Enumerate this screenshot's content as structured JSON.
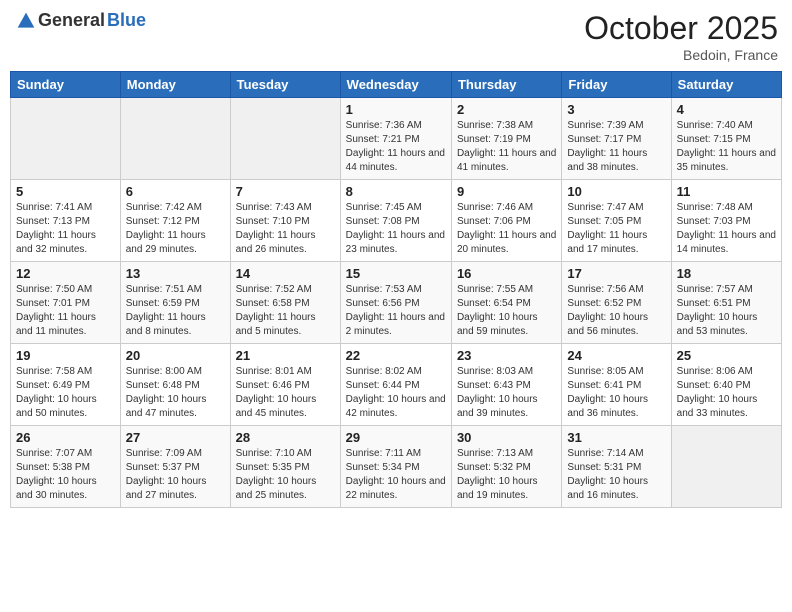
{
  "header": {
    "logo_general": "General",
    "logo_blue": "Blue",
    "month": "October 2025",
    "location": "Bedoin, France"
  },
  "weekdays": [
    "Sunday",
    "Monday",
    "Tuesday",
    "Wednesday",
    "Thursday",
    "Friday",
    "Saturday"
  ],
  "weeks": [
    [
      {
        "day": "",
        "info": ""
      },
      {
        "day": "",
        "info": ""
      },
      {
        "day": "",
        "info": ""
      },
      {
        "day": "1",
        "info": "Sunrise: 7:36 AM\nSunset: 7:21 PM\nDaylight: 11 hours and 44 minutes."
      },
      {
        "day": "2",
        "info": "Sunrise: 7:38 AM\nSunset: 7:19 PM\nDaylight: 11 hours and 41 minutes."
      },
      {
        "day": "3",
        "info": "Sunrise: 7:39 AM\nSunset: 7:17 PM\nDaylight: 11 hours and 38 minutes."
      },
      {
        "day": "4",
        "info": "Sunrise: 7:40 AM\nSunset: 7:15 PM\nDaylight: 11 hours and 35 minutes."
      }
    ],
    [
      {
        "day": "5",
        "info": "Sunrise: 7:41 AM\nSunset: 7:13 PM\nDaylight: 11 hours and 32 minutes."
      },
      {
        "day": "6",
        "info": "Sunrise: 7:42 AM\nSunset: 7:12 PM\nDaylight: 11 hours and 29 minutes."
      },
      {
        "day": "7",
        "info": "Sunrise: 7:43 AM\nSunset: 7:10 PM\nDaylight: 11 hours and 26 minutes."
      },
      {
        "day": "8",
        "info": "Sunrise: 7:45 AM\nSunset: 7:08 PM\nDaylight: 11 hours and 23 minutes."
      },
      {
        "day": "9",
        "info": "Sunrise: 7:46 AM\nSunset: 7:06 PM\nDaylight: 11 hours and 20 minutes."
      },
      {
        "day": "10",
        "info": "Sunrise: 7:47 AM\nSunset: 7:05 PM\nDaylight: 11 hours and 17 minutes."
      },
      {
        "day": "11",
        "info": "Sunrise: 7:48 AM\nSunset: 7:03 PM\nDaylight: 11 hours and 14 minutes."
      }
    ],
    [
      {
        "day": "12",
        "info": "Sunrise: 7:50 AM\nSunset: 7:01 PM\nDaylight: 11 hours and 11 minutes."
      },
      {
        "day": "13",
        "info": "Sunrise: 7:51 AM\nSunset: 6:59 PM\nDaylight: 11 hours and 8 minutes."
      },
      {
        "day": "14",
        "info": "Sunrise: 7:52 AM\nSunset: 6:58 PM\nDaylight: 11 hours and 5 minutes."
      },
      {
        "day": "15",
        "info": "Sunrise: 7:53 AM\nSunset: 6:56 PM\nDaylight: 11 hours and 2 minutes."
      },
      {
        "day": "16",
        "info": "Sunrise: 7:55 AM\nSunset: 6:54 PM\nDaylight: 10 hours and 59 minutes."
      },
      {
        "day": "17",
        "info": "Sunrise: 7:56 AM\nSunset: 6:52 PM\nDaylight: 10 hours and 56 minutes."
      },
      {
        "day": "18",
        "info": "Sunrise: 7:57 AM\nSunset: 6:51 PM\nDaylight: 10 hours and 53 minutes."
      }
    ],
    [
      {
        "day": "19",
        "info": "Sunrise: 7:58 AM\nSunset: 6:49 PM\nDaylight: 10 hours and 50 minutes."
      },
      {
        "day": "20",
        "info": "Sunrise: 8:00 AM\nSunset: 6:48 PM\nDaylight: 10 hours and 47 minutes."
      },
      {
        "day": "21",
        "info": "Sunrise: 8:01 AM\nSunset: 6:46 PM\nDaylight: 10 hours and 45 minutes."
      },
      {
        "day": "22",
        "info": "Sunrise: 8:02 AM\nSunset: 6:44 PM\nDaylight: 10 hours and 42 minutes."
      },
      {
        "day": "23",
        "info": "Sunrise: 8:03 AM\nSunset: 6:43 PM\nDaylight: 10 hours and 39 minutes."
      },
      {
        "day": "24",
        "info": "Sunrise: 8:05 AM\nSunset: 6:41 PM\nDaylight: 10 hours and 36 minutes."
      },
      {
        "day": "25",
        "info": "Sunrise: 8:06 AM\nSunset: 6:40 PM\nDaylight: 10 hours and 33 minutes."
      }
    ],
    [
      {
        "day": "26",
        "info": "Sunrise: 7:07 AM\nSunset: 5:38 PM\nDaylight: 10 hours and 30 minutes."
      },
      {
        "day": "27",
        "info": "Sunrise: 7:09 AM\nSunset: 5:37 PM\nDaylight: 10 hours and 27 minutes."
      },
      {
        "day": "28",
        "info": "Sunrise: 7:10 AM\nSunset: 5:35 PM\nDaylight: 10 hours and 25 minutes."
      },
      {
        "day": "29",
        "info": "Sunrise: 7:11 AM\nSunset: 5:34 PM\nDaylight: 10 hours and 22 minutes."
      },
      {
        "day": "30",
        "info": "Sunrise: 7:13 AM\nSunset: 5:32 PM\nDaylight: 10 hours and 19 minutes."
      },
      {
        "day": "31",
        "info": "Sunrise: 7:14 AM\nSunset: 5:31 PM\nDaylight: 10 hours and 16 minutes."
      },
      {
        "day": "",
        "info": ""
      }
    ]
  ]
}
